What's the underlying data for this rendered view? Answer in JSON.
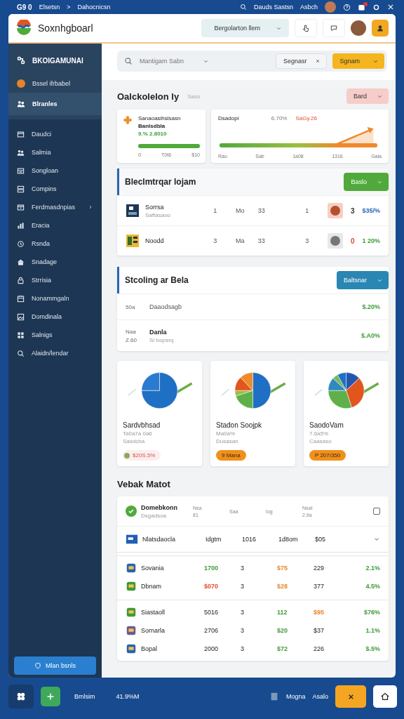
{
  "top_bar": {
    "brand": "G9 0",
    "breadcrumb": [
      "Elsetsn",
      "Dahocnicsn"
    ],
    "separator": ">",
    "user_name": "Dauds Sastsn",
    "user_role": "Asbch"
  },
  "header": {
    "title": "Soxnhgboarl",
    "dropdown": "Bergolarton llem"
  },
  "sidebar": {
    "title": "BKOIGAMUNAI",
    "pinned": [
      {
        "label": "Bssel ifrbabel",
        "selected": false
      },
      {
        "label": "Blranles",
        "selected": true
      }
    ],
    "items": [
      {
        "label": "Daudci",
        "expandable": false
      },
      {
        "label": "Salmia",
        "expandable": false
      },
      {
        "label": "Songloan",
        "expandable": false
      },
      {
        "label": "Compins",
        "expandable": false
      },
      {
        "label": "Ferdmasdnpias",
        "expandable": true
      },
      {
        "label": "Eracia",
        "expandable": false
      },
      {
        "label": "Rsnda",
        "expandable": false
      },
      {
        "label": "Snadage",
        "expandable": false
      },
      {
        "label": "Strrisia",
        "expandable": false
      },
      {
        "label": "Nonammgaln",
        "expandable": false
      },
      {
        "label": "Domdinala",
        "expandable": false
      },
      {
        "label": "Salnigs",
        "expandable": false
      },
      {
        "label": "Alaidn/lendar",
        "expandable": false
      }
    ],
    "button": "Mlan bsnls"
  },
  "filter_bar": {
    "search_placeholder": "Mantigam Sabn",
    "dropdown": "Segnasr",
    "action": "Sgnam"
  },
  "overview": {
    "title": "Oalckolelon ly",
    "subtitle": "Saso",
    "button": "Bard",
    "goal_card": {
      "title": "Sanaoasihslsasn",
      "subtitle": "Banlsdbla",
      "value": "9.% 2.8010",
      "level": 1,
      "ticks": [
        "0",
        "T0t6",
        "$10"
      ]
    },
    "trend_card": {
      "title": "Dsadopi",
      "change": "6.70%",
      "amount": "SaGy.26",
      "ticks": [
        "Rao",
        "Sab",
        "1a08",
        "1316",
        "Gala"
      ]
    }
  },
  "holdings": {
    "title": "Bleclmtrqar lojam",
    "button": "Baslo",
    "rows": [
      {
        "name": "Sorrsa",
        "sub": "Saftasaoo",
        "cells": [
          "1",
          "Mo",
          "33",
          "1"
        ],
        "count": {
          "text": "3",
          "color": "#333333"
        },
        "change": {
          "text": "$35/%",
          "color": "#2a64b0"
        }
      },
      {
        "name": "Noodd",
        "cells": [
          "3",
          "Ma",
          "33",
          "3"
        ],
        "count": {
          "text": "0",
          "color": "#e04a2a"
        },
        "change": {
          "text": "1 20%",
          "color": "#3f9a3a"
        }
      }
    ]
  },
  "stocking": {
    "title": "Stcoling ar Bela",
    "button": "Baltsnar",
    "rows": [
      {
        "codes": [
          "50a"
        ],
        "name": "Daaodsagb",
        "value": "$.20%"
      },
      {
        "codes": [
          "Naa",
          "Z.60"
        ],
        "name": "Danla",
        "sub": "S/ bopsrq",
        "value": "$.A0%"
      }
    ]
  },
  "pie_cards": [
    {
      "title": "Sardvbhsad",
      "lines": [
        "Ta0a7a 0a6",
        "Sasdcba"
      ],
      "badge": "$20S.5%",
      "kind": "dot"
    },
    {
      "title": "Stadon Soojpk",
      "lines": [
        "Ma0a%",
        "Dusasan"
      ],
      "badge": "9  Mana",
      "kind": "pill"
    },
    {
      "title": "SaodoVam",
      "lines": [
        "7.6a5%",
        "Caasaso"
      ],
      "badge": "P 207/350",
      "kind": "pill"
    }
  ],
  "market": {
    "title": "Vebak Matot",
    "head": {
      "name": "Domebkonn",
      "sub": "Dsgadsoa",
      "columns": [
        [
          "Nsa",
          "81"
        ],
        [
          "Saa"
        ],
        [
          "Iog"
        ],
        [
          "Nsat",
          "2.9a"
        ]
      ],
      "checked": false
    },
    "summary": {
      "name": "Nlatsdaocla",
      "cells": [
        "Idgtm",
        "1016",
        "1d8om",
        "$05"
      ],
      "expanded": true
    },
    "groups": [
      [
        {
          "name": "Sovania",
          "cells": [
            {
              "text": "1700",
              "color": "#3f9a3a"
            },
            {
              "text": "3"
            },
            {
              "text": "$75",
              "color": "#e8862a"
            },
            {
              "text": "229"
            },
            {
              "text": "2.1%",
              "color": "#3f9a3a"
            }
          ]
        },
        {
          "name": "Dbnam",
          "cells": [
            {
              "text": "$070",
              "color": "#e04a2a"
            },
            {
              "text": "3"
            },
            {
              "text": "$28",
              "color": "#e8862a"
            },
            {
              "text": "377"
            },
            {
              "text": "4.5%",
              "color": "#3f9a3a"
            }
          ]
        }
      ],
      [
        {
          "name": "Siastaoll",
          "cells": [
            {
              "text": "5016"
            },
            {
              "text": "3"
            },
            {
              "text": "112",
              "color": "#3f9a3a"
            },
            {
              "text": "$95",
              "color": "#e8862a"
            },
            {
              "text": "$76%",
              "color": "#3f9a3a"
            }
          ]
        },
        {
          "name": "Sornarla",
          "cells": [
            {
              "text": "2706"
            },
            {
              "text": "3"
            },
            {
              "text": "$20",
              "color": "#3f9a3a"
            },
            {
              "text": "$37"
            },
            {
              "text": "1.1%",
              "color": "#3f9a3a"
            }
          ]
        },
        {
          "name": "Bopal",
          "cells": [
            {
              "text": "2000"
            },
            {
              "text": "3"
            },
            {
              "text": "$72",
              "color": "#3f9a3a"
            },
            {
              "text": "226"
            },
            {
              "text": "$.5%",
              "color": "#3f9a3a"
            }
          ]
        }
      ]
    ]
  },
  "dock": {
    "label": "Bmlsim",
    "value": "41.9%M",
    "right_labels": [
      "Mogna",
      "Asalo"
    ]
  }
}
